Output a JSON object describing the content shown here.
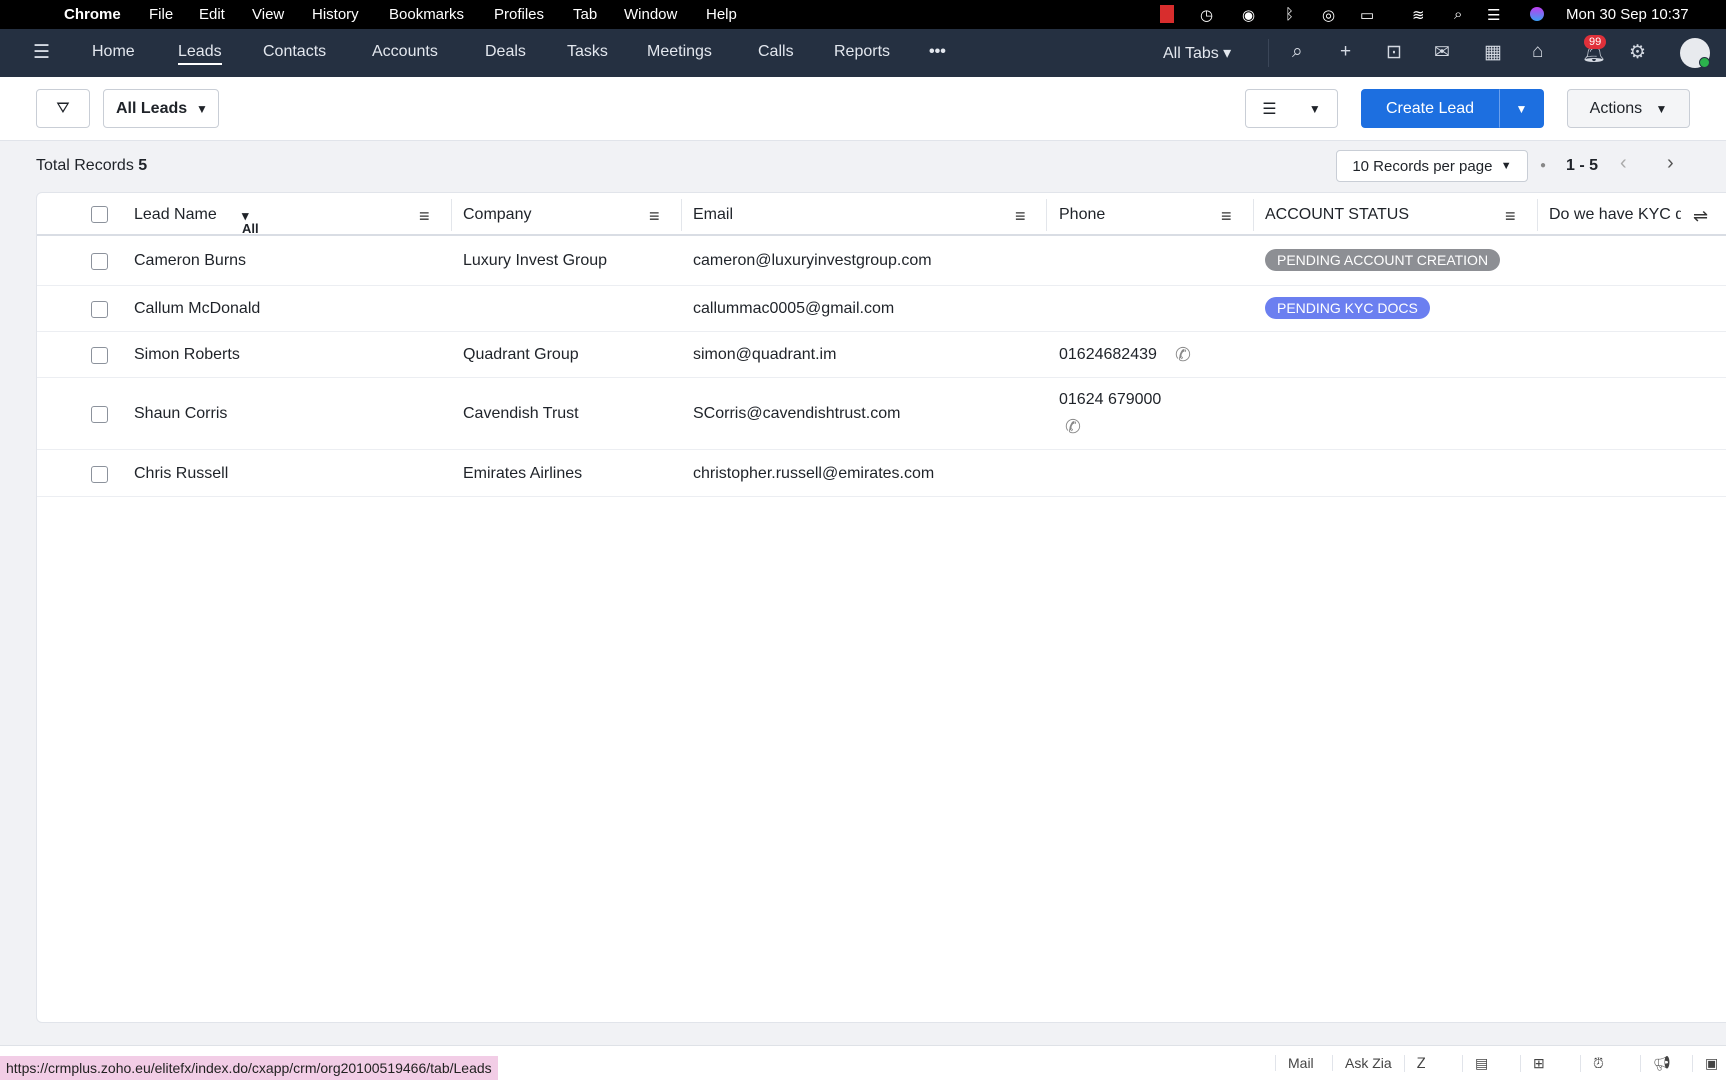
{
  "menubar": {
    "app": "Chrome",
    "items": [
      "File",
      "Edit",
      "View",
      "History",
      "Bookmarks",
      "Profiles",
      "Tab",
      "Window",
      "Help"
    ],
    "clock": "Mon 30 Sep  10:37"
  },
  "nav": {
    "tabs": [
      "Home",
      "Leads",
      "Contacts",
      "Accounts",
      "Deals",
      "Tasks",
      "Meetings",
      "Calls",
      "Reports"
    ],
    "more": "•••",
    "all_tabs": "All Tabs",
    "notification_count": "99"
  },
  "toolbar": {
    "view": "All Leads",
    "create": "Create Lead",
    "actions": "Actions"
  },
  "summary": {
    "total_label": "Total Records",
    "total": "5",
    "per_page": "10 Records per page",
    "range": "1 - 5"
  },
  "table": {
    "columns": [
      "Lead Name",
      "Company",
      "Email",
      "Phone",
      "ACCOUNT STATUS",
      "Do we have KYC d"
    ],
    "lead_filter": "All",
    "rows": [
      {
        "name": "Cameron Burns",
        "company": "Luxury Invest Group",
        "email": "cameron@luxuryinvestgroup.com",
        "phone": "",
        "status": "PENDING ACCOUNT CREATION"
      },
      {
        "name": "Callum McDonald",
        "company": "",
        "email": "callummac0005@gmail.com",
        "phone": "",
        "status": "PENDING KYC DOCS"
      },
      {
        "name": "Simon Roberts",
        "company": "Quadrant Group",
        "email": "simon@quadrant.im",
        "phone": "01624682439",
        "status": ""
      },
      {
        "name": "Shaun Corris",
        "company": "Cavendish Trust",
        "email": "SCorris@cavendishtrust.com",
        "phone": "01624 679000",
        "status": ""
      },
      {
        "name": "Chris Russell",
        "company": "Emirates Airlines",
        "email": "christopher.russell@emirates.com",
        "phone": "",
        "status": ""
      }
    ]
  },
  "statusbar": {
    "url": "https://crmplus.zoho.eu/elitefx/index.do/cxapp/crm/org20100519466/tab/Leads",
    "items": [
      "Mail",
      "Ask Zia"
    ]
  },
  "colors": {
    "primary": "#1d6fe0",
    "nav": "#253041",
    "badge_gray": "#8d8f94",
    "badge_blue": "#6b7ff0"
  }
}
